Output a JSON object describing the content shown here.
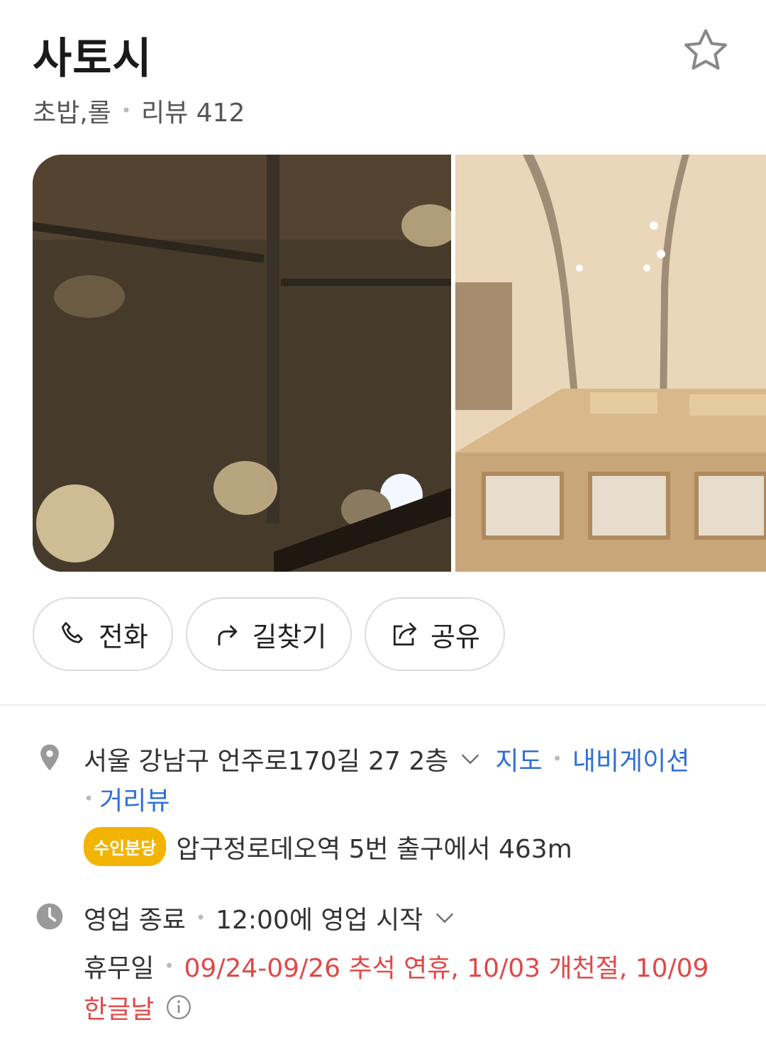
{
  "place": {
    "name": "사토시",
    "category": "초밥,롤",
    "review_label": "리뷰 412"
  },
  "actions": {
    "call_label": "전화",
    "route_label": "길찾기",
    "share_label": "공유"
  },
  "address": {
    "text": "서울 강남구 언주로170길 27 2층",
    "map_link": "지도",
    "navigation_link": "내비게이션",
    "streetview_link": "거리뷰"
  },
  "subway": {
    "badge": "수인분당",
    "badge_color": "#f2b400",
    "text": "압구정로데오역 5번 출구에서 463m"
  },
  "hours": {
    "status": "영업 종료",
    "next_open": "12:00에 영업 시작",
    "holiday_label": "휴무일",
    "holiday_dates_1": "09/24-09/26 추석 연휴, 10/03 개천절, 10/09",
    "holiday_dates_2": "한글날"
  },
  "icons": [
    "star-icon",
    "phone-icon",
    "route-arrow-icon",
    "share-icon",
    "location-pin-icon",
    "chevron-down-icon",
    "clock-icon",
    "info-icon"
  ],
  "colors": {
    "link": "#2f6fd6",
    "holiday": "#e04848"
  }
}
